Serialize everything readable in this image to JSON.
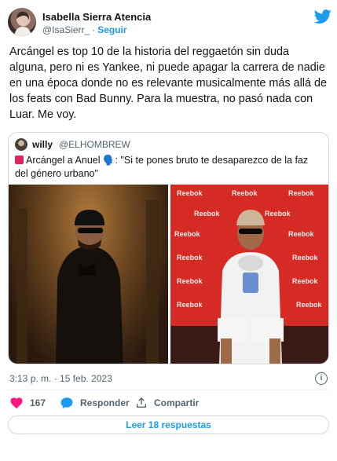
{
  "author": {
    "name": "Isabella Sierra Atencia",
    "handle": "@IsaSierr_",
    "separator": "·",
    "follow_label": "Seguir"
  },
  "tweet": {
    "text": "Arcángel es top 10 de la historia del reggaetón sin duda alguna, pero ni es Yankee, ni puede apagar la carrera de nadie en una época donde no es relevante musicalmente más allá de los feats con Bad Bunny. Para la muestra, no pasó nada con Luar. Me voy."
  },
  "quote": {
    "name": "willy",
    "handle": "@ELHOMBREW",
    "text": "Arcángel a Anuel 🗣️: \"Si te pones bruto te desaparezco de la faz del género urbano\""
  },
  "timestamp": "3:13 p. m. · 15 feb. 2023",
  "actions": {
    "likes": "167",
    "reply_label": "Responder",
    "share_label": "Compartir"
  },
  "replies_button": "Leer 18 respuestas",
  "colors": {
    "accent": "#1d9bf0",
    "like": "#f91880",
    "text": "#0f1419",
    "muted": "#536471",
    "border": "#cfd9de"
  },
  "icons": [
    "twitter-bird-icon",
    "info-icon",
    "heart-icon",
    "reply-bubble-icon",
    "share-icon",
    "siren-icon"
  ]
}
